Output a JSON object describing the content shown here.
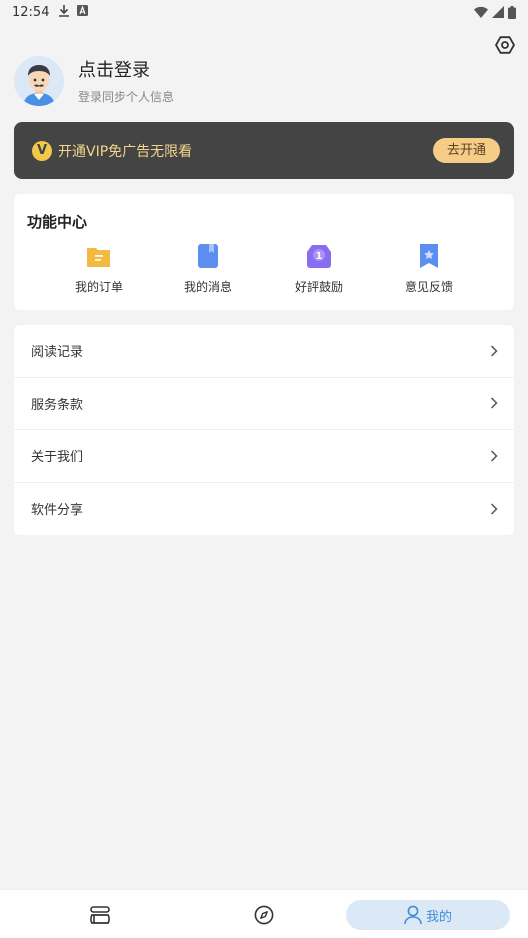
{
  "status_bar": {
    "time": "12:54"
  },
  "profile": {
    "title": "点击登录",
    "subtitle": "登录同步个人信息"
  },
  "vip": {
    "badge": "V",
    "text": "开通VIP免广告无限看",
    "button": "去开通"
  },
  "function_center": {
    "title": "功能中心",
    "items": [
      {
        "label": "我的订单",
        "icon": "orders-icon",
        "color": "#f4b940"
      },
      {
        "label": "我的消息",
        "icon": "messages-icon",
        "color": "#5b8ef0"
      },
      {
        "label": "好評鼓励",
        "icon": "rating-icon",
        "badge": "1",
        "color": "#8a6cf0"
      },
      {
        "label": "意见反馈",
        "icon": "feedback-icon",
        "color": "#5b8ef0"
      }
    ]
  },
  "menu": [
    {
      "label": "阅读记录"
    },
    {
      "label": "服务条款"
    },
    {
      "label": "关于我们"
    },
    {
      "label": "软件分享"
    }
  ],
  "bottom_nav": {
    "active_label": "我的",
    "accent": "#3f8ed6"
  }
}
